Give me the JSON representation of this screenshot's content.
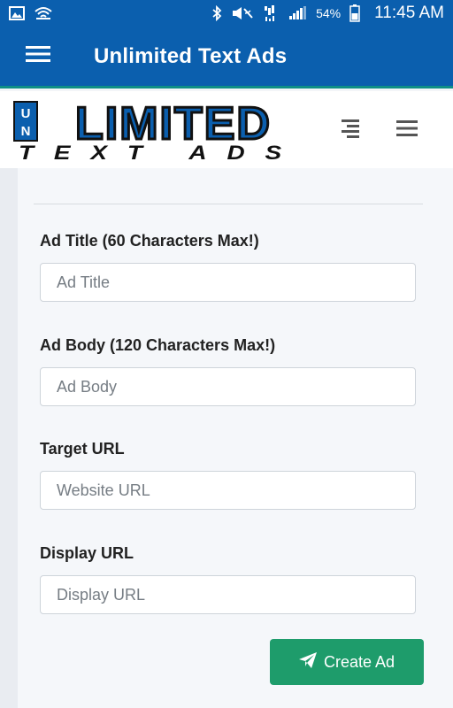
{
  "status_bar": {
    "battery_percent": "54%",
    "time": "11:45 AM",
    "icons": [
      "gallery-icon",
      "hotspot-icon",
      "bluetooth-icon",
      "mute-icon",
      "lte-icon",
      "signal-icon",
      "battery-icon"
    ]
  },
  "app_bar": {
    "title": "Unlimited Text Ads",
    "menu_icon": "hamburger-icon"
  },
  "site_header": {
    "logo_text_top": "UNLIMITED",
    "logo_text_bottom": "TEXT ADS",
    "icons": [
      "align-right-icon",
      "hamburger-icon"
    ]
  },
  "form": {
    "ad_title": {
      "label": "Ad Title (60 Characters Max!)",
      "placeholder": "Ad Title",
      "value": ""
    },
    "ad_body": {
      "label": "Ad Body (120 Characters Max!)",
      "placeholder": "Ad Body",
      "value": ""
    },
    "target_url": {
      "label": "Target URL",
      "placeholder": "Website URL",
      "value": ""
    },
    "display_url": {
      "label": "Display URL",
      "placeholder": "Display URL",
      "value": ""
    },
    "submit_label": "Create Ad",
    "submit_icon": "paper-plane-icon"
  },
  "colors": {
    "primary": "#0b5fae",
    "accent_line": "#0f8f86",
    "button": "#1e9c6b",
    "background": "#f3f5f8"
  }
}
